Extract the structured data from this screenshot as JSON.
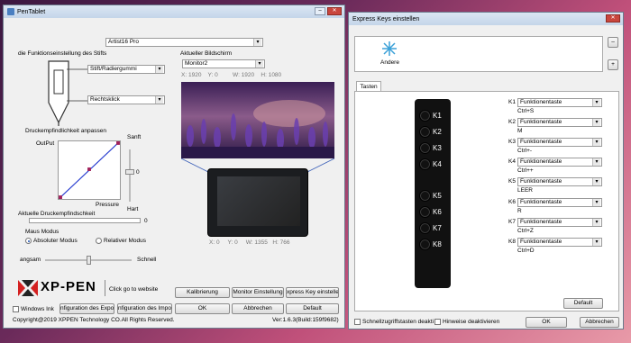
{
  "left_window": {
    "title": "PenTablet",
    "model_select": "Artist16 Pro",
    "pen_section_title": "die Funktionseinstellung des Stifts",
    "pen_upper_select": "Stift/Radiergummi",
    "pen_lower_select": "Rechtsklick",
    "pressure_title": "Druckempfindlichkeit anpassen",
    "output_label": "OutPut",
    "sanft_label": "Sanft",
    "hart_label": "Hart",
    "pressure_label": "Pressure",
    "slider_value": "0",
    "current_pressure_label": "Aktuelle Druckempfindschkeit",
    "current_pressure_value": "0",
    "mode_title": "Maus Modus",
    "absolute_mode": "Absoluter Modus",
    "relative_mode": "Relativer Modus",
    "speed_slow": "angsam",
    "speed_fast": "Schnell",
    "screen_title": "Aktueller Bildschirm",
    "monitor_select": "Monitor2",
    "screen_coords": {
      "x_label": "X:",
      "x": "1920",
      "y_label": "Y:",
      "y": "0",
      "w_label": "W:",
      "w": "1920",
      "h_label": "H:",
      "h": "1080"
    },
    "tablet_coords": {
      "x_label": "X:",
      "x": "0",
      "y_label": "Y:",
      "y": "0",
      "w_label": "W:",
      "w": "1355",
      "h_label": "H:",
      "h": "766"
    },
    "brand": "XP-PEN",
    "click_website": "Click go to website",
    "windows_ink": "Windows Ink",
    "save_config_btn": "nfiguration des Expo",
    "import_config_btn": "nfiguration des Impo",
    "copyright": "Copyright@2019  XPPEN Technology CO.All Rights Reserved.",
    "calibration_btn": "Kalibrierung",
    "monitor_settings_btn": "Monitor Einstellung",
    "express_key_btn": "xpress Key einstelle",
    "ok_btn": "OK",
    "cancel_btn": "Abbrechen",
    "default_btn": "Default",
    "version": "Ver:1.6.3(Build:159f9682)"
  },
  "right_window": {
    "title": "Express Keys einstellen",
    "app_label": "Andere",
    "tab_label": "Tasten",
    "keys": [
      {
        "key": "K1",
        "function": "Funktionentaste",
        "shortcut": "Ctrl+S"
      },
      {
        "key": "K2",
        "function": "Funktionentaste",
        "shortcut": "M"
      },
      {
        "key": "K3",
        "function": "Funktionentaste",
        "shortcut": "Ctrl+-"
      },
      {
        "key": "K4",
        "function": "Funktionentaste",
        "shortcut": "Ctrl++"
      },
      {
        "key": "K5",
        "function": "Funktionentaste",
        "shortcut": "LEER"
      },
      {
        "key": "K6",
        "function": "Funktionentaste",
        "shortcut": "R"
      },
      {
        "key": "K7",
        "function": "Funktionentaste",
        "shortcut": "Ctrl+Z"
      },
      {
        "key": "K8",
        "function": "Funktionentaste",
        "shortcut": "Ctrl+D"
      }
    ],
    "default_btn": "Default",
    "shortcut_check": "Schnellzugriffstasten deakti",
    "hints_check": "Hinweise deaktivieren",
    "ok_btn": "OK",
    "cancel_btn": "Abbrechen"
  },
  "colors": {
    "accent": "#1a50b0",
    "titlebar": "#c4d5e9",
    "close": "#c9463d",
    "curve": "#2a3fd0",
    "curve_end": "#a0205a"
  }
}
